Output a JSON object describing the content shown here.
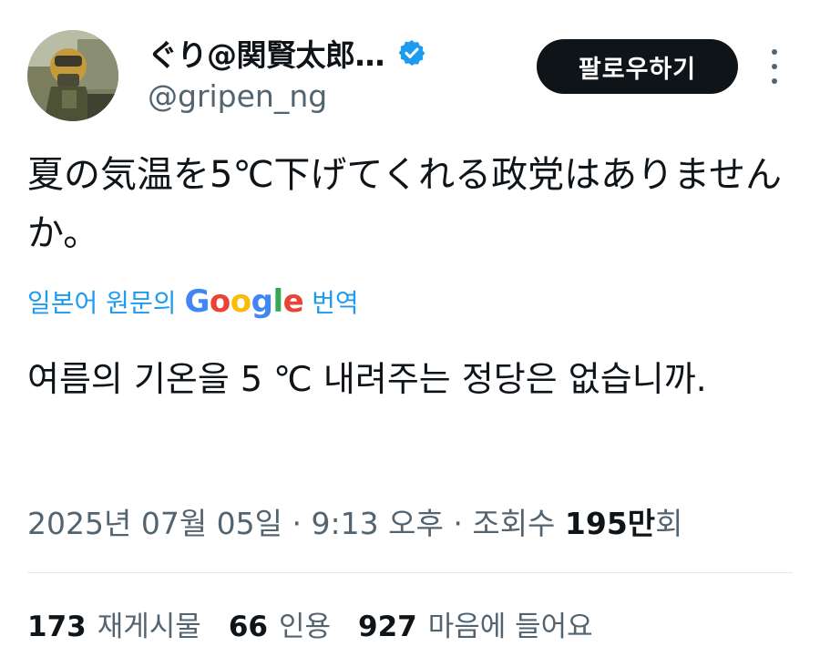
{
  "author": {
    "display_name": "ぐり@関賢太郎…",
    "handle": "@gripen_ng",
    "verified_icon": "verified-badge-icon",
    "avatar_icon": "avatar-pilot-photo"
  },
  "follow_button": {
    "label": "팔로우하기"
  },
  "more_menu": {
    "icon": "more-vertical-icon"
  },
  "tweet": {
    "text": "夏の気温を5℃下げてくれる政党はありませんか。"
  },
  "translation": {
    "prefix": "일본어 원문의",
    "provider": "Google",
    "suffix": "번역",
    "text": "여름의 기온을 5 ℃ 내려주는 정당은 없습니까."
  },
  "meta": {
    "date": "2025년 07월 05일",
    "separator": " · ",
    "time": "9:13 오후",
    "views_label": "조회수",
    "views_count": "195만",
    "views_suffix": "회"
  },
  "stats": [
    {
      "count": "173",
      "label": "재게시물"
    },
    {
      "count": "66",
      "label": "인용"
    },
    {
      "count": "927",
      "label": "마음에 들어요"
    }
  ],
  "colors": {
    "accent": "#1d9bf0",
    "text": "#0f1419",
    "secondary": "#536471",
    "button_bg": "#0f1419",
    "google_blue": "#4285f4",
    "google_red": "#ea4335",
    "google_yellow": "#fbbc05",
    "google_green": "#34a853"
  }
}
